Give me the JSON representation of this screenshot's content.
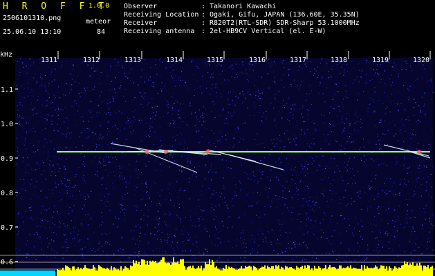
{
  "header": {
    "app_title": "H R O F F T",
    "app_version": "1.0.0",
    "file_name": "2506101310.png",
    "timestamp": "25.06.10 13:10",
    "detect_label": "meteor",
    "detect_count": "84"
  },
  "station_info": [
    {
      "label": "Observer",
      "sep": ":",
      "value": "Takanori Kawachi"
    },
    {
      "label": "Receiving Location",
      "sep": ":",
      "value": "Ogaki, Gifu, JAPAN (136.60E, 35.35N)"
    },
    {
      "label": "Receiver",
      "sep": ":",
      "value": "R820T2(RTL-SDR) SDR-Sharp 53.1000MHz"
    },
    {
      "label": "Receiving antenna",
      "sep": ":",
      "value": "2el-HB9CV Vertical (el. E-W)"
    }
  ],
  "plot": {
    "unit_label": "kHz",
    "time_ticks": [
      "1311",
      "1312",
      "1313",
      "1314",
      "1315",
      "1316",
      "1317",
      "1318",
      "1319",
      "1320"
    ],
    "freq_ticks": [
      "1.1",
      "1.0",
      "0.9",
      "0.8",
      "0.7",
      "0.6"
    ],
    "colors": {
      "background": "#000000",
      "noise_base": "#0a0a46",
      "carrier": "#a0ff70",
      "meteor": "#e6f5ff",
      "activity": "#ffff00",
      "activity_low": "#00d8ff",
      "labels": "#ffffff",
      "header_title": "#ffff00"
    }
  }
}
